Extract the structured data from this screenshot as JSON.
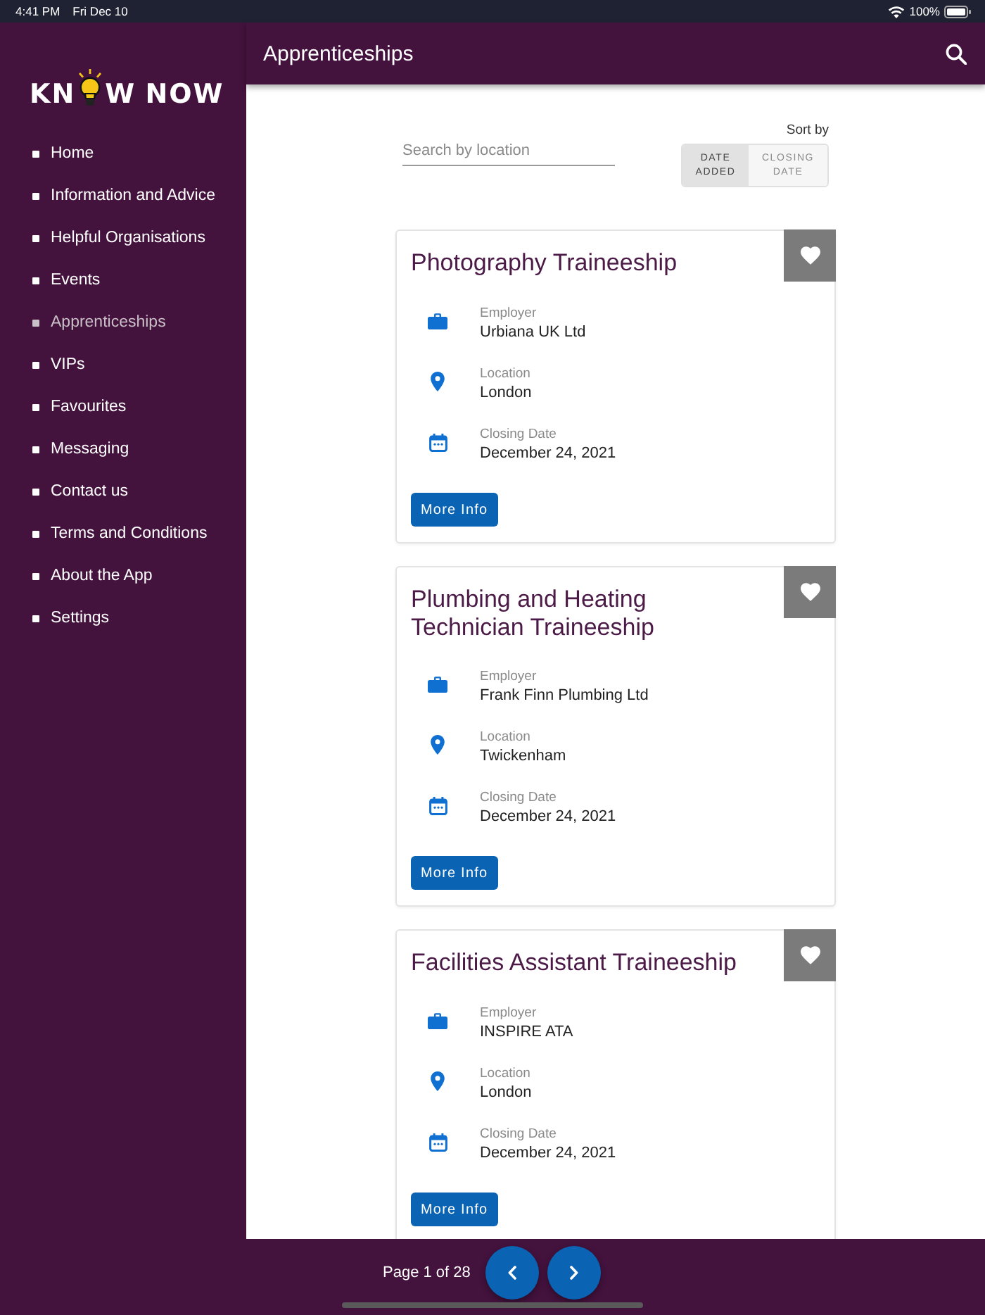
{
  "status_bar": {
    "time": "4:41 PM",
    "date": "Fri Dec 10",
    "battery": "100%"
  },
  "sidebar": {
    "logo": {
      "before": "KN",
      "after": "W NOW"
    },
    "items": [
      {
        "label": "Home",
        "selected": false
      },
      {
        "label": "Information and Advice",
        "selected": false
      },
      {
        "label": "Helpful Organisations",
        "selected": false
      },
      {
        "label": "Events",
        "selected": false
      },
      {
        "label": "Apprenticeships",
        "selected": true
      },
      {
        "label": "VIPs",
        "selected": false
      },
      {
        "label": "Favourites",
        "selected": false
      },
      {
        "label": "Messaging",
        "selected": false
      },
      {
        "label": "Contact us",
        "selected": false
      },
      {
        "label": "Terms and Conditions",
        "selected": false
      },
      {
        "label": "About the App",
        "selected": false
      },
      {
        "label": "Settings",
        "selected": false
      }
    ]
  },
  "app_bar": {
    "title": "Apprenticeships"
  },
  "filters": {
    "search": {
      "placeholder": "Search by location"
    },
    "sort": {
      "label": "Sort by",
      "options": [
        {
          "label": "DATE ADDED",
          "selected": true
        },
        {
          "label": "CLOSING DATE",
          "selected": false
        }
      ]
    }
  },
  "listings": [
    {
      "title": "Photography Traineeship",
      "fields": [
        {
          "kind": "employer",
          "label": "Employer",
          "value": "Urbiana UK Ltd"
        },
        {
          "kind": "location",
          "label": "Location",
          "value": "London"
        },
        {
          "kind": "closing_date",
          "label": "Closing Date",
          "value": "December 24, 2021"
        }
      ],
      "button": "More Info"
    },
    {
      "title": "Plumbing and Heating Technician Traineeship",
      "fields": [
        {
          "kind": "employer",
          "label": "Employer",
          "value": "Frank Finn Plumbing Ltd"
        },
        {
          "kind": "location",
          "label": "Location",
          "value": "Twickenham"
        },
        {
          "kind": "closing_date",
          "label": "Closing Date",
          "value": "December 24, 2021"
        }
      ],
      "button": "More Info"
    },
    {
      "title": "Facilities Assistant Traineeship",
      "fields": [
        {
          "kind": "employer",
          "label": "Employer",
          "value": "INSPIRE ATA"
        },
        {
          "kind": "location",
          "label": "Location",
          "value": "London"
        },
        {
          "kind": "closing_date",
          "label": "Closing Date",
          "value": "December 24, 2021"
        }
      ],
      "button": "More Info"
    }
  ],
  "pagination": {
    "label": "Page 1 of 28"
  }
}
